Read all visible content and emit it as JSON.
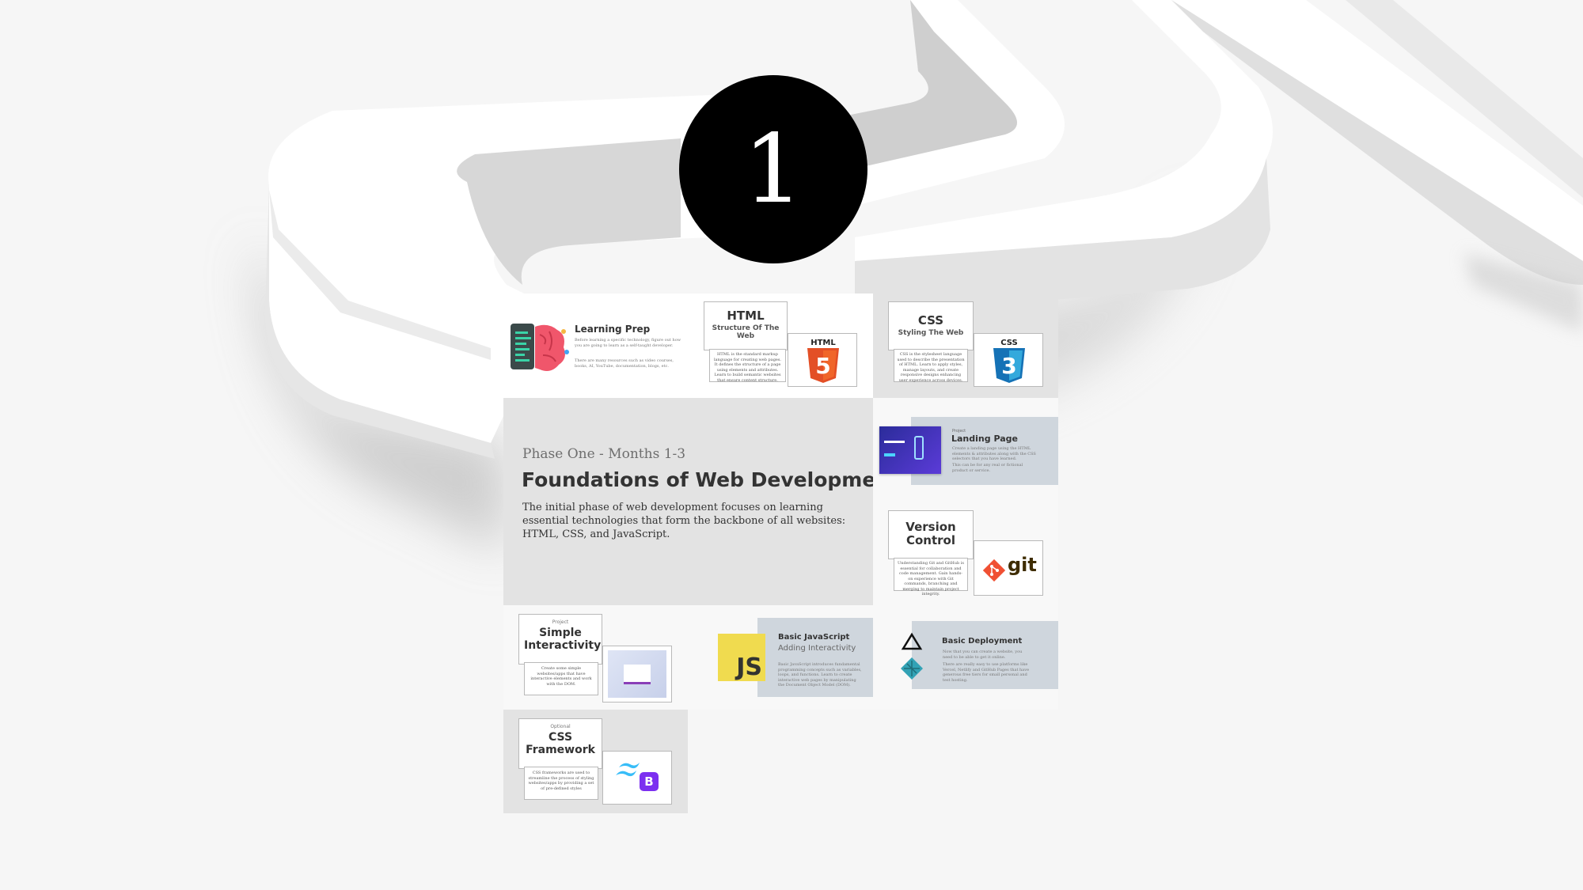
{
  "badge": {
    "number": "1"
  },
  "phase": {
    "label": "Phase One - Months 1-3",
    "title": "Foundations of Web Development",
    "description": "The initial phase of web development focuses on learning essential technologies that form the backbone of all websites: HTML, CSS, and JavaScript."
  },
  "learning_prep": {
    "title": "Learning Prep",
    "text1": "Before learning a specific technology, figure out how you are going to learn as a self-taught developer.",
    "text2": "There are many resources such as video courses, books, AI, YouTube, documentation, blogs, etc."
  },
  "html": {
    "title": "HTML",
    "subtitle": "Structure Of The Web",
    "text": "HTML is the standard markup language for creating web pages. It defines the structure of a page using elements and attributes. Learn to build semantic websites that ensure content structure.",
    "logo_label": "HTML",
    "logo_number": "5"
  },
  "css": {
    "title": "CSS",
    "subtitle": "Styling The Web",
    "text": "CSS is the stylesheet language used to describe the presentation of HTML. Learn to apply styles, manage layouts, and create responsive designs enhancing user experience across devices.",
    "logo_label": "CSS",
    "logo_number": "3"
  },
  "landing": {
    "kicker": "Project",
    "title": "Landing Page",
    "text1": "Create a landing page using the HTML elements & attributes along with the CSS selectors that you have learned.",
    "text2": "This can be for any real or fictional product or service."
  },
  "version_control": {
    "title": "Version Control",
    "text": "Understanding Git and GitHub is essential for collaboration and code management. Gain hands-on experience with Git commands, branching and merging to maintain project integrity.",
    "logo_text": "git"
  },
  "simple_interactivity": {
    "kicker": "Project",
    "title": "Simple Interactivity",
    "text": "Create some simple websites/apps that have interactive elements and work with the DOM."
  },
  "basic_js": {
    "title": "Basic JavaScript",
    "subtitle": "Adding Interactivity",
    "text": "Basic JavaScript introduces fundamental programming concepts such as variables, loops, and functions. Learn to create interactive web pages by manipulating the Document Object Model (DOM).",
    "logo_text": "JS"
  },
  "deployment": {
    "title": "Basic Deployment",
    "text1": "Now that you can create a website, you need to be able to get it online.",
    "text2": "There are really easy to use platforms like Vercel, Netlify and GitHub Pages that have generous free tiers for small personal and test hosting."
  },
  "css_framework": {
    "kicker": "Optional",
    "title": "CSS Framework",
    "text": "CSS frameworks are used to streamline the process of styling websites/apps by providing a set of pre-defined styles",
    "logo_text": "B"
  },
  "colors": {
    "badge": "#000000",
    "html_orange": "#e34f26",
    "css_blue": "#1f6fbf",
    "git_red": "#f05033",
    "js_yellow": "#f0db4f",
    "bootstrap_purple": "#7c2ff0",
    "tailwind_cyan": "#38bdf8"
  }
}
